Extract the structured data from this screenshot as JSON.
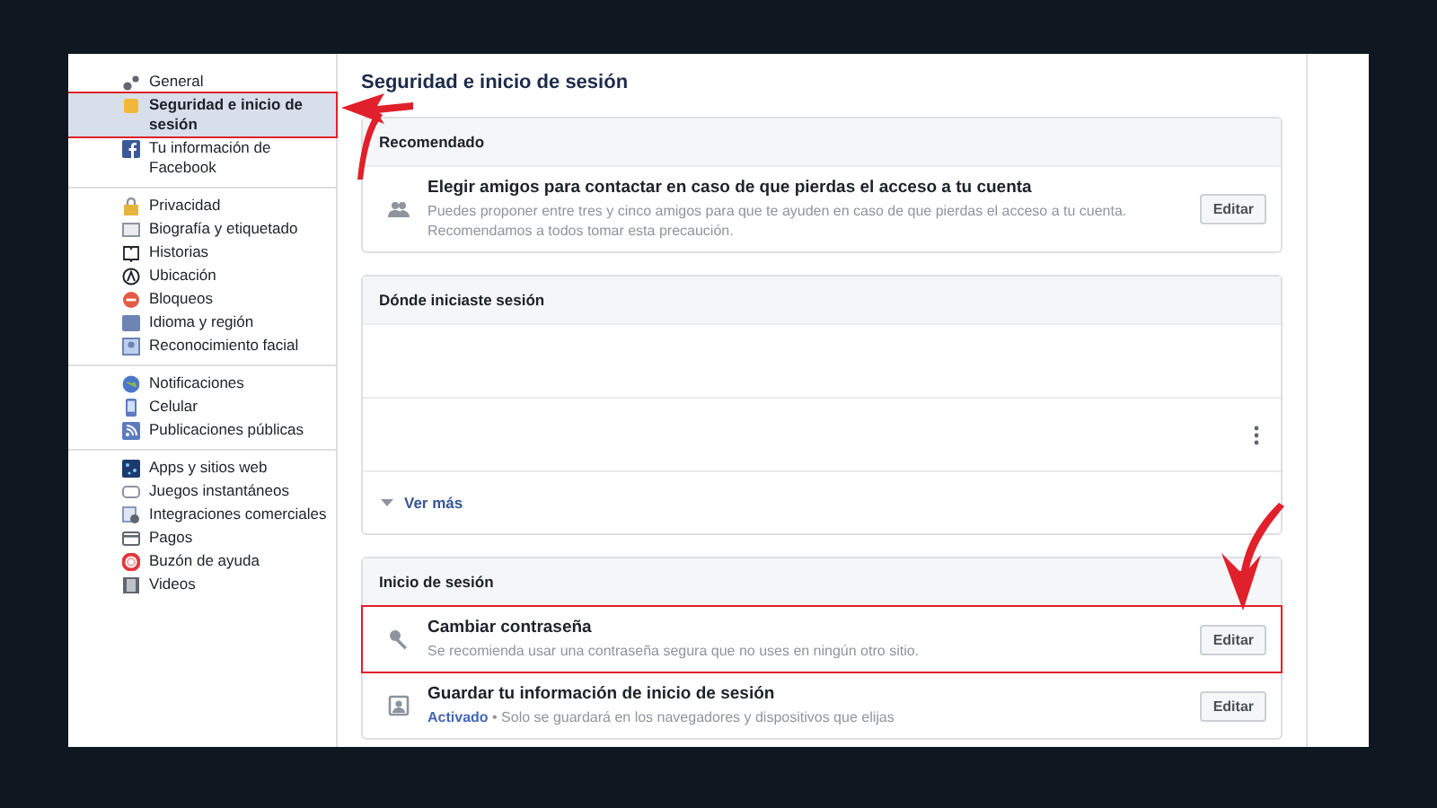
{
  "sidebar": {
    "groups": [
      {
        "items": [
          {
            "label": "General",
            "selected": false,
            "highlighted": false
          },
          {
            "label": "Seguridad e inicio de sesión",
            "selected": true,
            "highlighted": true
          },
          {
            "label": "Tu información de Facebook",
            "selected": false,
            "highlighted": false
          }
        ]
      },
      {
        "items": [
          {
            "label": "Privacidad",
            "selected": false,
            "highlighted": false
          },
          {
            "label": "Biografía y etiquetado",
            "selected": false,
            "highlighted": false
          },
          {
            "label": "Historias",
            "selected": false,
            "highlighted": false
          },
          {
            "label": "Ubicación",
            "selected": false,
            "highlighted": false
          },
          {
            "label": "Bloqueos",
            "selected": false,
            "highlighted": false
          },
          {
            "label": "Idioma y región",
            "selected": false,
            "highlighted": false
          },
          {
            "label": "Reconocimiento facial",
            "selected": false,
            "highlighted": false
          }
        ]
      },
      {
        "items": [
          {
            "label": "Notificaciones",
            "selected": false,
            "highlighted": false
          },
          {
            "label": "Celular",
            "selected": false,
            "highlighted": false
          },
          {
            "label": "Publicaciones públicas",
            "selected": false,
            "highlighted": false
          }
        ]
      },
      {
        "items": [
          {
            "label": "Apps y sitios web",
            "selected": false,
            "highlighted": false
          },
          {
            "label": "Juegos instantáneos",
            "selected": false,
            "highlighted": false
          },
          {
            "label": "Integraciones comerciales",
            "selected": false,
            "highlighted": false
          },
          {
            "label": "Pagos",
            "selected": false,
            "highlighted": false
          },
          {
            "label": "Buzón de ayuda",
            "selected": false,
            "highlighted": false
          },
          {
            "label": "Videos",
            "selected": false,
            "highlighted": false
          }
        ]
      }
    ]
  },
  "page_title": "Seguridad e inicio de sesión",
  "sections": [
    {
      "kind": "rows",
      "title": "Recomendado",
      "rows": [
        {
          "title": "Elegir amigos para contactar en caso de que pierdas el acceso a tu cuenta",
          "description": "Puedes proponer entre tres y cinco amigos para que te ayuden en caso de que pierdas el acceso a tu cuenta. Recomendamos a todos tomar esta precaución.",
          "button": "Editar",
          "highlighted": false
        }
      ]
    },
    {
      "kind": "sessions",
      "title": "Dónde iniciaste sesión",
      "more": "Ver más"
    },
    {
      "kind": "rows",
      "title": "Inicio de sesión",
      "rows": [
        {
          "title": "Cambiar contraseña",
          "description": "Se recomienda usar una contraseña segura que no uses en ningún otro sitio.",
          "button": "Editar",
          "highlighted": true
        },
        {
          "title": "Guardar tu información de inicio de sesión",
          "status": "Activado",
          "description": "• Solo se guardará en los navegadores y dispositivos que elijas",
          "button": "Editar",
          "highlighted": false
        }
      ]
    }
  ]
}
